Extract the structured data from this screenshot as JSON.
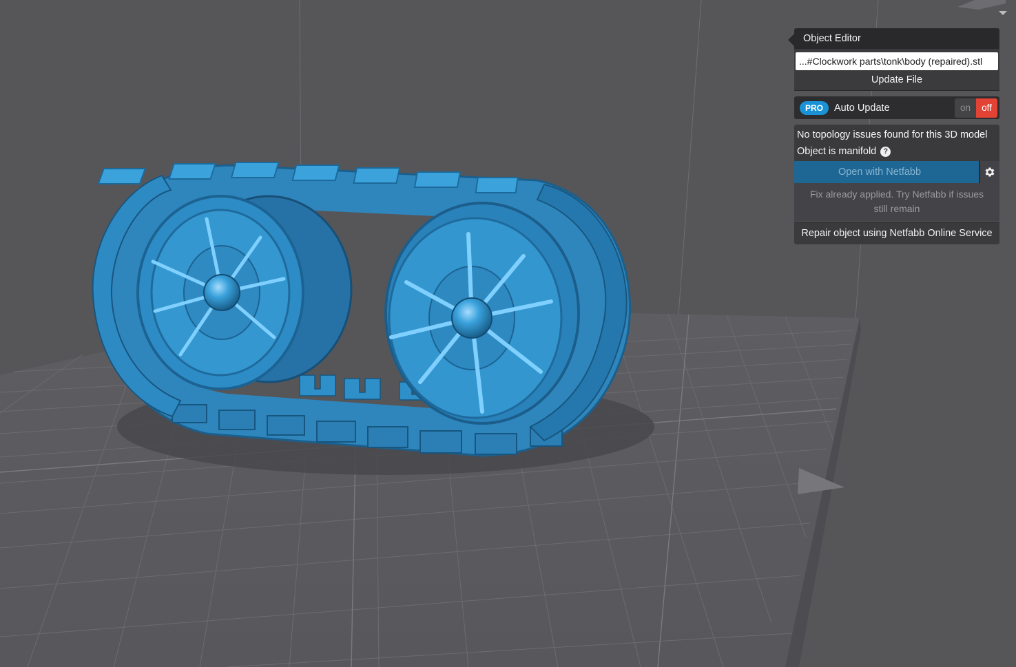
{
  "object_editor": {
    "title": "Object Editor",
    "file_path": "...#Clockwork parts\\tonk\\body (repaired).stl",
    "update_file_label": "Update File",
    "auto_update": {
      "badge": "PRO",
      "label": "Auto Update",
      "toggle_on": "on",
      "toggle_off": "off",
      "state": "off"
    },
    "topology_status": "No topology issues found for this 3D model",
    "manifold_status": "Object is manifold",
    "help_symbol": "?",
    "open_netfabb_label": "Open with Netfabb",
    "fix_note": "Fix already applied. Try Netfabb if issues still remain",
    "repair_label": "Repair object using Netfabb Online Service"
  },
  "icons": {
    "help": "question-circle-icon",
    "settings": "gear-icon"
  },
  "colors": {
    "model": "#2f94cc",
    "background": "#565659",
    "grid": "#6b6b6e",
    "pro_badge": "#1a93d6",
    "toggle_off": "#e34334",
    "netfabb_button": "#1e6694"
  }
}
